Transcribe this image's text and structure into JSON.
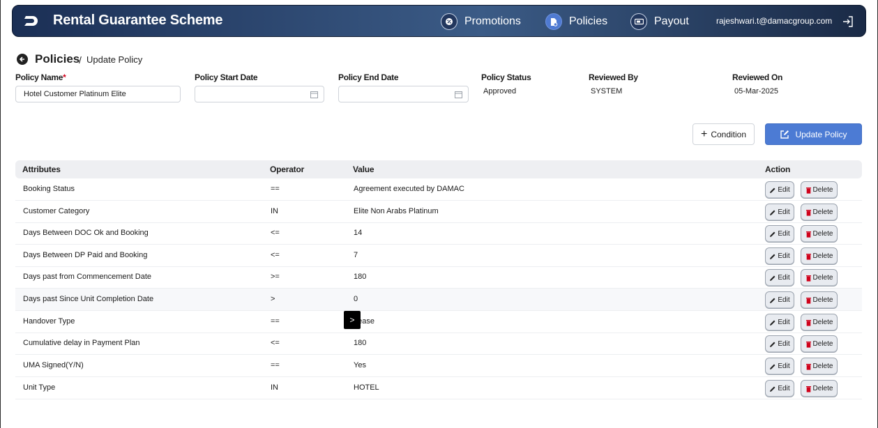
{
  "header": {
    "app_title": "Rental Guarantee Scheme",
    "nav": [
      {
        "label": "Promotions",
        "icon": "badge-icon"
      },
      {
        "label": "Policies",
        "icon": "document-icon",
        "active": true
      },
      {
        "label": "Payout",
        "icon": "money-icon"
      }
    ],
    "user_email": "rajeshwari.t@damacgroup.com",
    "colors": {
      "accent": "#4c7bd4",
      "header_dark": "#1b2f55"
    }
  },
  "breadcrumb": {
    "title": "Policies",
    "separator": "/",
    "current": "Update Policy"
  },
  "form": {
    "policy_name_label": "Policy Name",
    "required_mark": "*",
    "policy_name_value": "Hotel Customer Platinum Elite",
    "start_date_label": "Policy Start Date",
    "start_date_value": "",
    "end_date_label": "Policy End Date",
    "end_date_value": "",
    "status_label": "Policy Status",
    "status_value": "Approved",
    "reviewed_by_label": "Reviewed By",
    "reviewed_by_value": "SYSTEM",
    "reviewed_on_label": "Reviewed On",
    "reviewed_on_value": "05-Mar-2025"
  },
  "actions": {
    "condition_label": "Condition",
    "update_label": "Update Policy"
  },
  "table": {
    "headers": {
      "attributes": "Attributes",
      "operator": "Operator",
      "value": "Value",
      "action": "Action"
    },
    "edit_label": "Edit",
    "delete_label": "Delete",
    "rows": [
      {
        "attribute": "Booking Status",
        "operator": "==",
        "value": "Agreement executed by DAMAC"
      },
      {
        "attribute": "Customer Category",
        "operator": "IN",
        "value": "Elite Non Arabs Platinum"
      },
      {
        "attribute": "Days Between DOC Ok and Booking",
        "operator": "<=",
        "value": "14"
      },
      {
        "attribute": "Days Between DP Paid and Booking",
        "operator": "<=",
        "value": "7"
      },
      {
        "attribute": "Days past from Commencement Date",
        "operator": ">=",
        "value": "180"
      },
      {
        "attribute": "Days past Since Unit Completion Date",
        "operator": ">",
        "value": "0"
      },
      {
        "attribute": "Handover Type",
        "operator": "==",
        "value": "Lease"
      },
      {
        "attribute": "Cumulative delay in Payment Plan",
        "operator": "<=",
        "value": "180"
      },
      {
        "attribute": "UMA Signed(Y/N)",
        "operator": "==",
        "value": "Yes"
      },
      {
        "attribute": "Unit Type",
        "operator": "IN",
        "value": "HOTEL"
      }
    ]
  },
  "tooltip": {
    "text": ">"
  }
}
